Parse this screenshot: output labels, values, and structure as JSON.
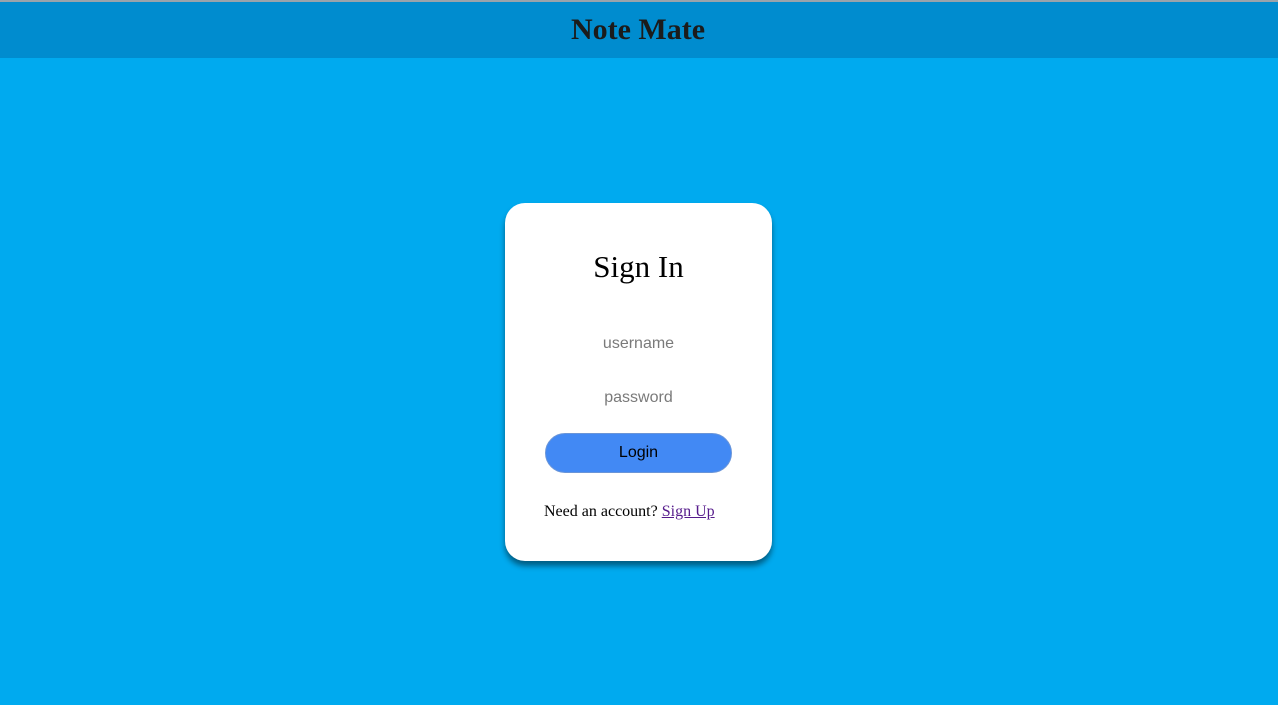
{
  "header": {
    "title": "Note Mate"
  },
  "signin": {
    "title": "Sign In",
    "username_placeholder": "username",
    "password_placeholder": "password",
    "login_label": "Login",
    "prompt_text": "Need an account?",
    "signup_label": "Sign Up"
  },
  "colors": {
    "page_background": "#00aaef",
    "header_background": "#008ccf",
    "button_background": "#4289f4",
    "visited_link": "#551a8b"
  }
}
